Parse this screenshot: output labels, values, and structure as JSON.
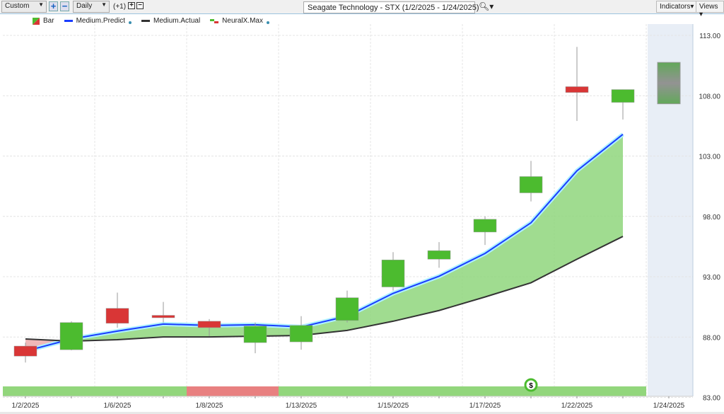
{
  "toolbar": {
    "preset": "Custom",
    "interval": "Daily",
    "offset": "(+1)",
    "title": "Seagate Technology - STX (1/2/2025 - 1/24/2025)",
    "indicators": "Indicators",
    "views": "Views"
  },
  "legend": [
    {
      "label": "Bar"
    },
    {
      "label": "Medium.Predict",
      "color": "#1a3cff"
    },
    {
      "label": "Medium.Actual",
      "color": "#333333"
    },
    {
      "label": "NeuralX.Max"
    }
  ],
  "chart_data": {
    "type": "candlestick",
    "ylim": [
      83,
      113
    ],
    "yticks": [
      "113.00",
      "108.00",
      "103.00",
      "98.00",
      "93.00",
      "88.00",
      "83.00"
    ],
    "xlabels": [
      "1/2/2025",
      "1/6/2025",
      "1/8/2025",
      "1/13/2025",
      "1/15/2025",
      "1/17/2025",
      "1/22/2025",
      "1/24/2025"
    ],
    "candles": [
      {
        "o": 87.25,
        "h": 87.54,
        "l": 85.89,
        "c": 86.42
      },
      {
        "o": 86.95,
        "h": 89.3,
        "l": 86.9,
        "c": 89.2
      },
      {
        "o": 90.38,
        "h": 91.68,
        "l": 88.78,
        "c": 89.14
      },
      {
        "o": 89.8,
        "h": 90.91,
        "l": 89.2,
        "c": 89.6
      },
      {
        "o": 89.31,
        "h": 89.49,
        "l": 88.07,
        "c": 88.78
      },
      {
        "o": 87.54,
        "h": 89.2,
        "l": 86.66,
        "c": 88.9
      },
      {
        "o": 87.6,
        "h": 89.73,
        "l": 86.95,
        "c": 88.96
      },
      {
        "o": 89.37,
        "h": 91.85,
        "l": 89.2,
        "c": 91.26
      },
      {
        "o": 92.15,
        "h": 95.04,
        "l": 91.85,
        "c": 94.39
      },
      {
        "o": 94.45,
        "h": 95.87,
        "l": 93.74,
        "c": 95.16
      },
      {
        "o": 96.7,
        "h": 98.0,
        "l": 95.63,
        "c": 97.76
      },
      {
        "o": 99.95,
        "h": 102.6,
        "l": 99.24,
        "c": 101.3
      },
      {
        "o": 108.75,
        "h": 112.05,
        "l": 105.91,
        "c": 108.27
      },
      {
        "o": 107.45,
        "h": 108.51,
        "l": 106.03,
        "c": 108.51
      }
    ],
    "forecast": {
      "low": 107.33,
      "high": 110.76
    },
    "series": [
      {
        "name": "Medium.Predict",
        "values": [
          86.83,
          87.84,
          88.49,
          89.08,
          88.96,
          89.02,
          88.84,
          89.73,
          91.62,
          93.04,
          94.93,
          97.47,
          101.78,
          104.8
        ]
      },
      {
        "name": "Medium.Actual",
        "values": [
          87.84,
          87.66,
          87.78,
          88.01,
          88.01,
          88.07,
          88.13,
          88.55,
          89.31,
          90.2,
          91.32,
          92.5,
          94.45,
          96.34
        ]
      }
    ],
    "signal_strip": [
      "up",
      "up",
      "up",
      "up",
      "down",
      "down",
      "up",
      "up",
      "up",
      "up",
      "up",
      "up",
      "up",
      "up"
    ],
    "colors": {
      "up": "#4cbb2f",
      "down": "#d93636"
    }
  }
}
